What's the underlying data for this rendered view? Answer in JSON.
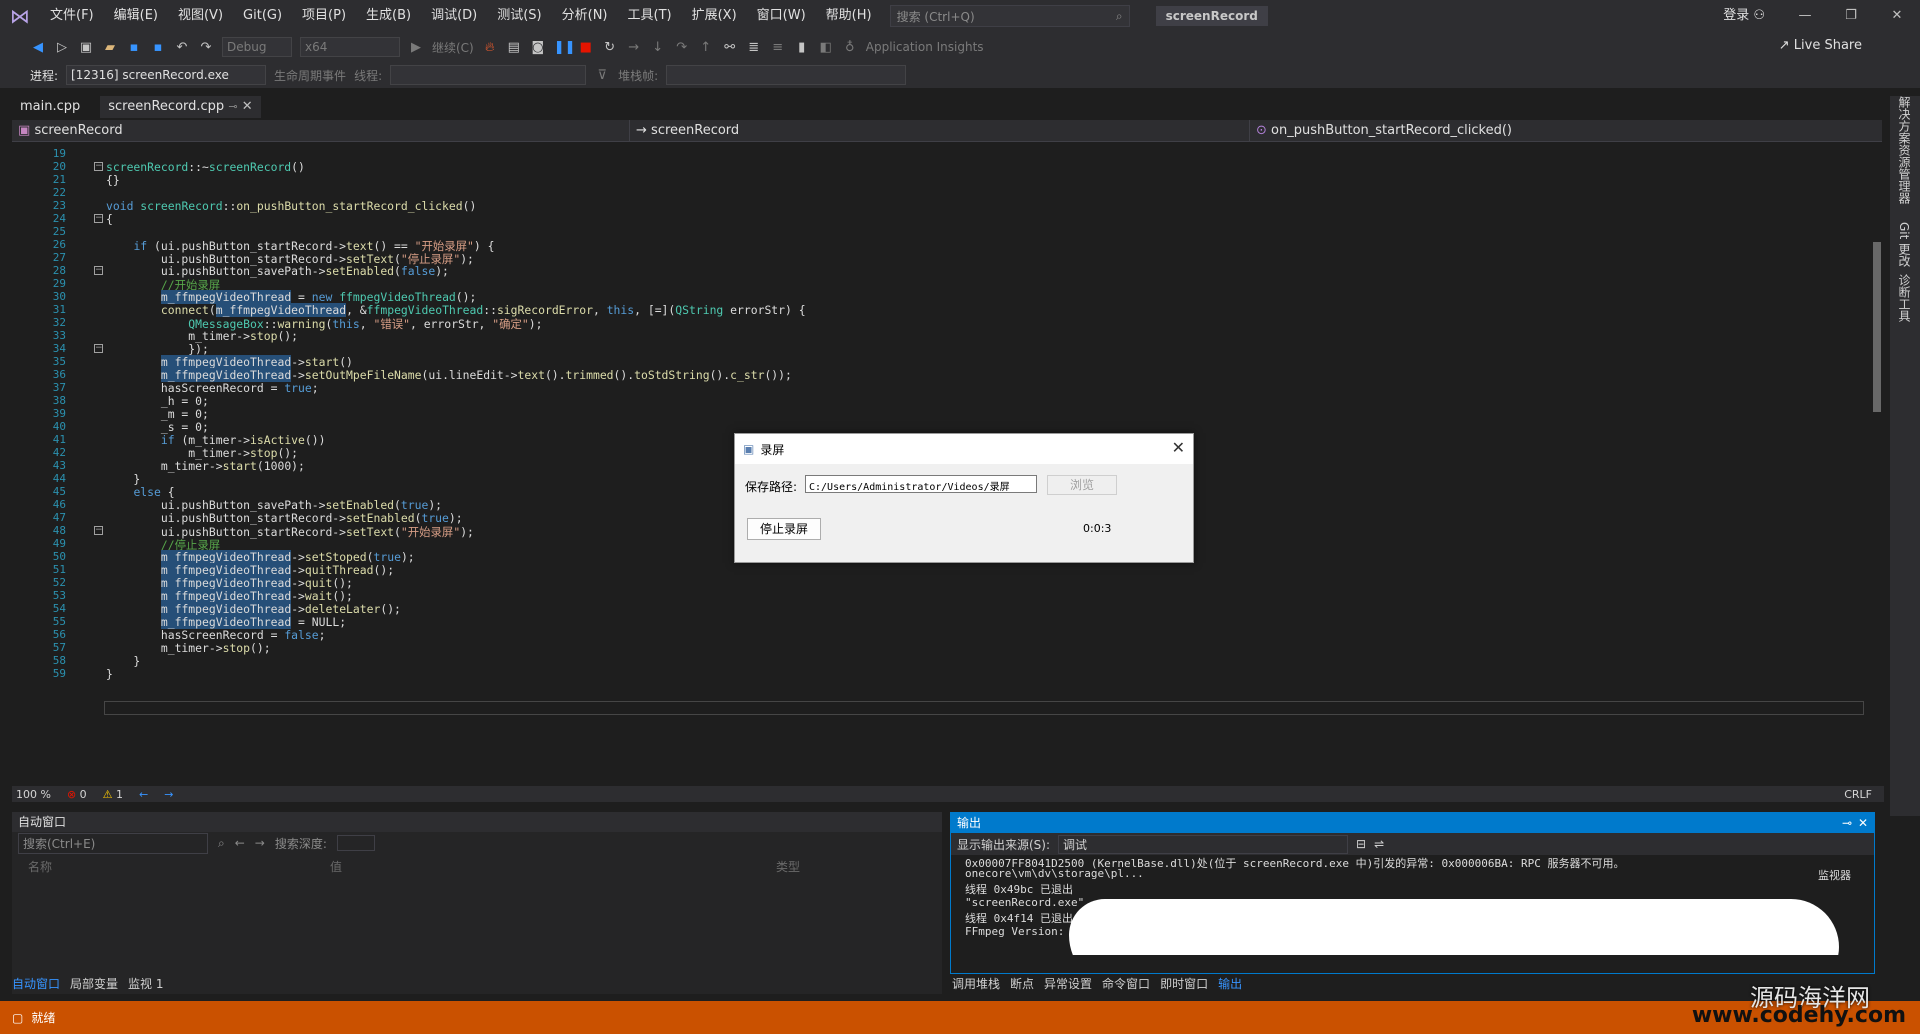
{
  "menu": [
    "文件(F)",
    "编辑(E)",
    "视图(V)",
    "Git(G)",
    "项目(P)",
    "生成(B)",
    "调试(D)",
    "测试(S)",
    "分析(N)",
    "工具(T)",
    "扩展(X)",
    "窗口(W)",
    "帮助(H)"
  ],
  "search_placeholder": "搜索 (Ctrl+Q)",
  "solution_title": "screenRecord",
  "login": "登录",
  "toolbar": {
    "config": "Debug",
    "platform": "x64",
    "continue": "继续(C)",
    "insights": "Application Insights",
    "live_share": "Live Share"
  },
  "process": {
    "label": "进程:",
    "value": "[12316] screenRecord.exe",
    "lifecycle": "生命周期事件",
    "thread_label": "线程:",
    "stack_label": "堆栈帧:"
  },
  "tabs": [
    "main.cpp",
    "screenRecord.cpp"
  ],
  "nav": {
    "project": "screenRecord",
    "scope": "screenRecord",
    "member": "on_pushButton_startRecord_clicked()"
  },
  "line_numbers": [
    "19",
    "20",
    "21",
    "22",
    "23",
    "24",
    "25",
    "26",
    "27",
    "28",
    "29",
    "30",
    "31",
    "32",
    "33",
    "34",
    "35",
    "36",
    "37",
    "38",
    "39",
    "40",
    "41",
    "42",
    "43",
    "44",
    "45",
    "46",
    "47",
    "48",
    "49",
    "50",
    "51",
    "52",
    "53",
    "54",
    "55",
    "56",
    "57",
    "58",
    "59"
  ],
  "editor_status": {
    "zoom": "100 %",
    "errors": "0",
    "warnings": "1",
    "eol": "CRLF"
  },
  "right_tabs": [
    "解决方案资源管理器",
    "Git 更改",
    "诊断工具"
  ],
  "autos": {
    "title": "自动窗口",
    "search": "搜索(Ctrl+E)",
    "depth": "搜索深度:",
    "col_name": "名称",
    "col_value": "值",
    "col_type": "类型"
  },
  "bottom_tabs_left": [
    "自动窗口",
    "局部变量",
    "监视 1"
  ],
  "output": {
    "title": "输出",
    "source_label": "显示输出来源(S):",
    "source_value": "调试",
    "lines": [
      "0x00007FF8041D2500 (KernelBase.dll)处(位于 screenRecord.exe 中)引发的异常: 0x000006BA: RPC 服务器不可用。",
      "onecore\\vm\\dv\\storage\\pl...",
      "线程 0x49bc 已退出",
      "\"screenRecord.exe\"",
      "线程 0x4f14 已退出",
      "FFmpeg Version:  4."
    ],
    "trailing": "监视器"
  },
  "bottom_tabs_right": [
    "调用堆栈",
    "断点",
    "异常设置",
    "命令窗口",
    "即时窗口",
    "输出"
  ],
  "status": "就绪",
  "watermark": {
    "cn": "源码海洋网",
    "url": "www.codehy.com"
  },
  "dialog": {
    "title": "录屏",
    "path_label": "保存路径:",
    "path_value": "C:/Users/Administrator/Videos/录屏",
    "browse": "浏览",
    "stop": "停止录屏",
    "timer": "0:0:3"
  }
}
